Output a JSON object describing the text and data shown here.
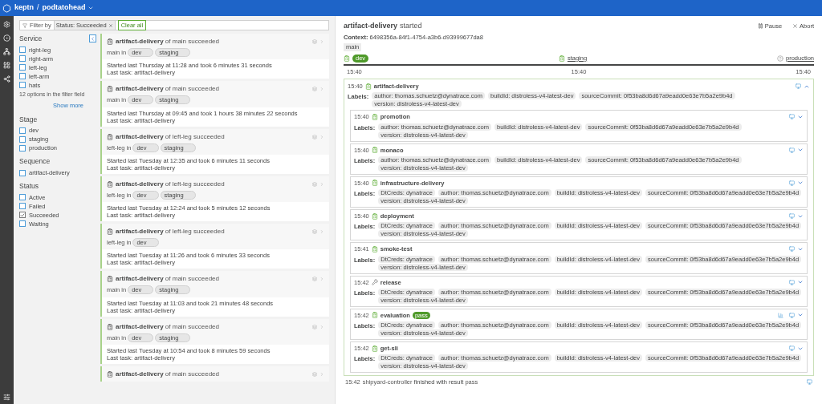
{
  "topbar": {
    "brand": "keptn",
    "separator": "/",
    "project": "podtatohead"
  },
  "filter": {
    "label": "Filter by",
    "chips": [
      "Status: Succeeded"
    ],
    "clear": "Clear all"
  },
  "sidebar": {
    "groups": [
      {
        "title": "Service",
        "options": [
          {
            "label": "right-leg",
            "checked": false
          },
          {
            "label": "right-arm",
            "checked": false
          },
          {
            "label": "left-leg",
            "checked": false
          },
          {
            "label": "left-arm",
            "checked": false
          },
          {
            "label": "hats",
            "checked": false
          }
        ],
        "note": "12 options in the filter field",
        "more": "Show more"
      },
      {
        "title": "Stage",
        "options": [
          {
            "label": "dev",
            "checked": false
          },
          {
            "label": "staging",
            "checked": false
          },
          {
            "label": "production",
            "checked": false
          }
        ]
      },
      {
        "title": "Sequence",
        "options": [
          {
            "label": "artifact-delivery",
            "checked": false
          }
        ]
      },
      {
        "title": "Status",
        "options": [
          {
            "label": "Active",
            "checked": false
          },
          {
            "label": "Failed",
            "checked": false
          },
          {
            "label": "Succeeded",
            "checked": true
          },
          {
            "label": "Waiting",
            "checked": false
          }
        ]
      }
    ]
  },
  "sequences": [
    {
      "name": "artifact-delivery",
      "of": "of main succeeded",
      "service": "main in",
      "stages": [
        "dev",
        "staging"
      ],
      "started": "Started last Thursday at 11:28 and took 6 minutes 31 seconds",
      "last_task": "Last task: artifact-delivery"
    },
    {
      "name": "artifact-delivery",
      "of": "of main succeeded",
      "service": "main in",
      "stages": [
        "dev",
        "staging"
      ],
      "started": "Started last Thursday at 09:45 and took 1 hours 38 minutes 22 seconds",
      "last_task": "Last task: artifact-delivery"
    },
    {
      "name": "artifact-delivery",
      "of": "of left-leg succeeded",
      "service": "left-leg in",
      "stages": [
        "dev",
        "staging"
      ],
      "started": "Started last Tuesday at 12:35 and took 6 minutes 11 seconds",
      "last_task": "Last task: artifact-delivery"
    },
    {
      "name": "artifact-delivery",
      "of": "of left-leg succeeded",
      "service": "left-leg in",
      "stages": [
        "dev",
        "staging"
      ],
      "started": "Started last Tuesday at 12:24 and took 5 minutes 12 seconds",
      "last_task": "Last task: artifact-delivery"
    },
    {
      "name": "artifact-delivery",
      "of": "of left-leg succeeded",
      "service": "left-leg in",
      "stages": [
        "dev"
      ],
      "started": "Started last Tuesday at 11:26 and took 6 minutes 33 seconds",
      "last_task": "Last task: artifact-delivery"
    },
    {
      "name": "artifact-delivery",
      "of": "of main succeeded",
      "service": "main in",
      "stages": [
        "dev",
        "staging"
      ],
      "started": "Started last Tuesday at 11:03 and took 21 minutes 48 seconds",
      "last_task": "Last task: artifact-delivery"
    },
    {
      "name": "artifact-delivery",
      "of": "of main succeeded",
      "service": "main in",
      "stages": [
        "dev",
        "staging"
      ],
      "started": "Started last Tuesday at 10:54 and took 8 minutes 59 seconds",
      "last_task": "Last task: artifact-delivery"
    },
    {
      "name": "artifact-delivery",
      "of": "of main succeeded"
    }
  ],
  "detail": {
    "title": "artifact-delivery",
    "status": "started",
    "pause": "Pause",
    "abort": "Abort",
    "context_label": "Context:",
    "context": "6498356a-84f1-4754-a3b6-d93999677da8",
    "tag": "main",
    "timeline": [
      {
        "stage": "dev",
        "time": "15:40",
        "selected": true,
        "kind": "done"
      },
      {
        "stage": "staging",
        "time": "15:40",
        "selected": false,
        "kind": "done"
      },
      {
        "stage": "production",
        "time": "15:40",
        "selected": false,
        "kind": "pending"
      }
    ],
    "root": {
      "time": "15:40",
      "name": "artifact-delivery",
      "expanded": true,
      "labels_title": "Labels:",
      "labels": [
        "author: thomas.schuetz@dynatrace.com",
        "buildId: distroless-v4-latest-dev",
        "sourceCommit: 0f53ba8d6d67a9eadd0e63e7b5a2e9b4d",
        "version: distroless-v4-latest-dev"
      ]
    },
    "tasks": [
      {
        "time": "15:40",
        "name": "promotion",
        "kind": "done",
        "expanded": false,
        "labels_title": "Labels:",
        "labels": [
          "author: thomas.schuetz@dynatrace.com",
          "buildId: distroless-v4-latest-dev",
          "sourceCommit: 0f53ba8d6d67a9eadd0e63e7b5a2e9b4d",
          "version: distroless-v4-latest-dev"
        ]
      },
      {
        "time": "15:40",
        "name": "monaco",
        "kind": "done",
        "expanded": false,
        "labels_title": "Labels:",
        "labels": [
          "author: thomas.schuetz@dynatrace.com",
          "buildId: distroless-v4-latest-dev",
          "sourceCommit: 0f53ba8d6d67a9eadd0e63e7b5a2e9b4d",
          "version: distroless-v4-latest-dev"
        ]
      },
      {
        "time": "15:40",
        "name": "infrastructure-delivery",
        "kind": "done",
        "expanded": false,
        "labels_title": "Labels:",
        "labels": [
          "DtCreds: dynatrace",
          "author: thomas.schuetz@dynatrace.com",
          "buildId: distroless-v4-latest-dev",
          "sourceCommit: 0f53ba8d6d67a9eadd0e63e7b5a2e9b4d",
          "version: distroless-v4-latest-dev"
        ]
      },
      {
        "time": "15:40",
        "name": "deployment",
        "kind": "done",
        "expanded": false,
        "labels_title": "Labels:",
        "labels": [
          "DtCreds: dynatrace",
          "author: thomas.schuetz@dynatrace.com",
          "buildId: distroless-v4-latest-dev",
          "sourceCommit: 0f53ba8d6d67a9eadd0e63e7b5a2e9b4d",
          "version: distroless-v4-latest-dev"
        ]
      },
      {
        "time": "15:41",
        "name": "smoke-test",
        "kind": "done",
        "expanded": false,
        "labels_title": "Labels:",
        "labels": [
          "DtCreds: dynatrace",
          "author: thomas.schuetz@dynatrace.com",
          "buildId: distroless-v4-latest-dev",
          "sourceCommit: 0f53ba8d6d67a9eadd0e63e7b5a2e9b4d",
          "version: distroless-v4-latest-dev"
        ]
      },
      {
        "time": "15:42",
        "name": "release",
        "kind": "release",
        "expanded": false,
        "labels_title": "Labels:",
        "labels": [
          "DtCreds: dynatrace",
          "author: thomas.schuetz@dynatrace.com",
          "buildId: distroless-v4-latest-dev",
          "sourceCommit: 0f53ba8d6d67a9eadd0e63e7b5a2e9b4d",
          "version: distroless-v4-latest-dev"
        ]
      },
      {
        "time": "15:42",
        "name": "evaluation",
        "kind": "done",
        "badge": "pass",
        "expanded": false,
        "labels_title": "Labels:",
        "labels": [
          "DtCreds: dynatrace",
          "author: thomas.schuetz@dynatrace.com",
          "buildId: distroless-v4-latest-dev",
          "sourceCommit: 0f53ba8d6d67a9eadd0e63e7b5a2e9b4d",
          "version: distroless-v4-latest-dev"
        ]
      },
      {
        "time": "15:42",
        "name": "get-sli",
        "kind": "done",
        "expanded": false,
        "labels_title": "Labels:",
        "labels": [
          "DtCreds: dynatrace",
          "author: thomas.schuetz@dynatrace.com",
          "buildId: distroless-v4-latest-dev",
          "sourceCommit: 0f53ba8d6d67a9eadd0e63e7b5a2e9b4d",
          "version: distroless-v4-latest-dev"
        ]
      }
    ],
    "footer": {
      "time": "15:42",
      "source": "shipyard-controller",
      "text": "finished with result",
      "result": "pass"
    }
  }
}
